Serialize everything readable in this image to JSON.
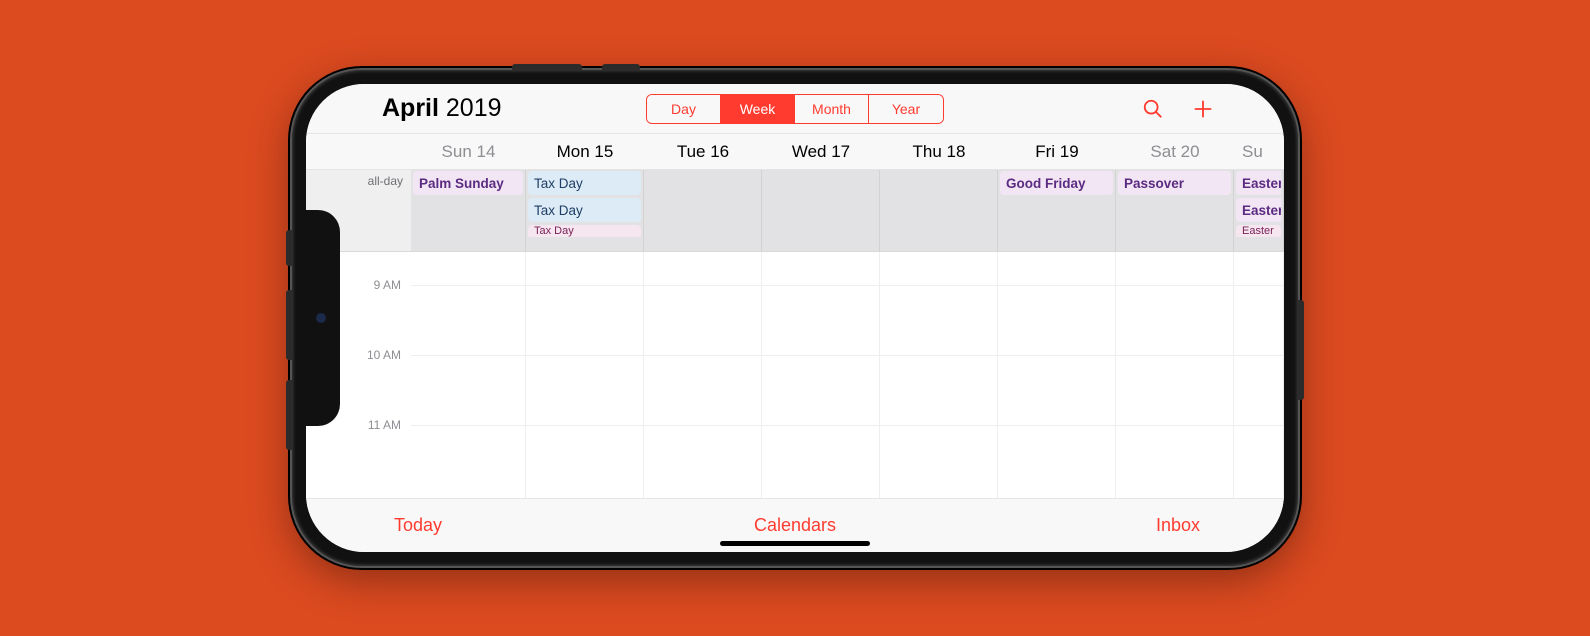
{
  "header": {
    "month": "April",
    "year": "2019",
    "segments": {
      "day": "Day",
      "week": "Week",
      "month": "Month",
      "year": "Year",
      "active": "week"
    }
  },
  "days": {
    "sun": {
      "label": "Sun 14",
      "weekend": true
    },
    "mon": {
      "label": "Mon 15"
    },
    "tue": {
      "label": "Tue 16"
    },
    "wed": {
      "label": "Wed 17"
    },
    "thu": {
      "label": "Thu 18"
    },
    "fri": {
      "label": "Fri 19"
    },
    "sat": {
      "label": "Sat 20",
      "weekend": true
    },
    "next": {
      "label": "Su"
    }
  },
  "allday": {
    "label": "all-day",
    "events": {
      "palmSunday": "Palm Sunday",
      "taxDay1": "Tax Day",
      "taxDay2": "Tax Day",
      "taxDay3": "Tax Day",
      "goodFriday": "Good Friday",
      "passover": "Passover",
      "easter1": "Easter",
      "easter2": "Easter",
      "easter3": "Easter"
    }
  },
  "hours": {
    "h9": "9 AM",
    "h10": "10 AM",
    "h11": "11 AM"
  },
  "toolbar": {
    "today": "Today",
    "calendars": "Calendars",
    "inbox": "Inbox"
  },
  "icons": {
    "search": "search-icon",
    "add": "add-icon"
  }
}
